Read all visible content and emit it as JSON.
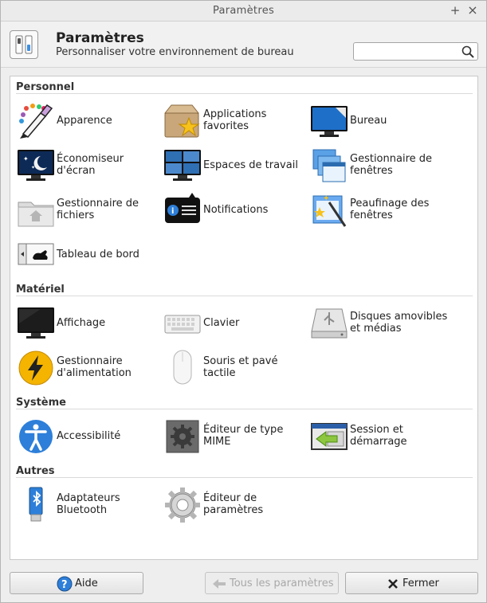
{
  "window": {
    "title": "Paramètres",
    "pin_symbol": "+",
    "close_symbol": "×"
  },
  "header": {
    "title": "Paramètres",
    "subtitle": "Personnaliser votre environnement de bureau"
  },
  "search": {
    "value": "",
    "placeholder": ""
  },
  "sections": [
    {
      "title": "Personnel",
      "items": [
        {
          "label": "Apparence",
          "icon": "palette-icon"
        },
        {
          "label": "Applications favorites",
          "icon": "favorite-apps-icon"
        },
        {
          "label": "Bureau",
          "icon": "desktop-icon"
        },
        {
          "label": "Économiseur d'écran",
          "icon": "screensaver-icon"
        },
        {
          "label": "Espaces de travail",
          "icon": "workspaces-icon"
        },
        {
          "label": "Gestionnaire de fenêtres",
          "icon": "window-manager-icon"
        },
        {
          "label": "Gestionnaire de fichiers",
          "icon": "file-manager-icon"
        },
        {
          "label": "Notifications",
          "icon": "notifications-icon"
        },
        {
          "label": "Peaufinage des fenêtres",
          "icon": "window-tweaks-icon"
        },
        {
          "label": "Tableau de bord",
          "icon": "panel-icon"
        }
      ]
    },
    {
      "title": "Matériel",
      "items": [
        {
          "label": "Affichage",
          "icon": "display-icon"
        },
        {
          "label": "Clavier",
          "icon": "keyboard-icon"
        },
        {
          "label": "Disques amovibles et médias",
          "icon": "removable-drive-icon"
        },
        {
          "label": "Gestionnaire d'alimentation",
          "icon": "power-icon"
        },
        {
          "label": "Souris et pavé tactile",
          "icon": "mouse-icon"
        }
      ]
    },
    {
      "title": "Système",
      "items": [
        {
          "label": "Accessibilité",
          "icon": "accessibility-icon"
        },
        {
          "label": "Éditeur de type MIME",
          "icon": "mime-editor-icon"
        },
        {
          "label": "Session et démarrage",
          "icon": "session-icon"
        }
      ]
    },
    {
      "title": "Autres",
      "items": [
        {
          "label": "Adaptateurs Bluetooth",
          "icon": "bluetooth-icon"
        },
        {
          "label": "Éditeur de paramètres",
          "icon": "settings-editor-icon"
        }
      ]
    }
  ],
  "footer": {
    "help_label": "Aide",
    "all_settings_label": "Tous les paramètres",
    "close_label": "Fermer"
  },
  "colors": {
    "accent_blue": "#3a7bd5",
    "disabled_text": "#a8a8a8"
  }
}
